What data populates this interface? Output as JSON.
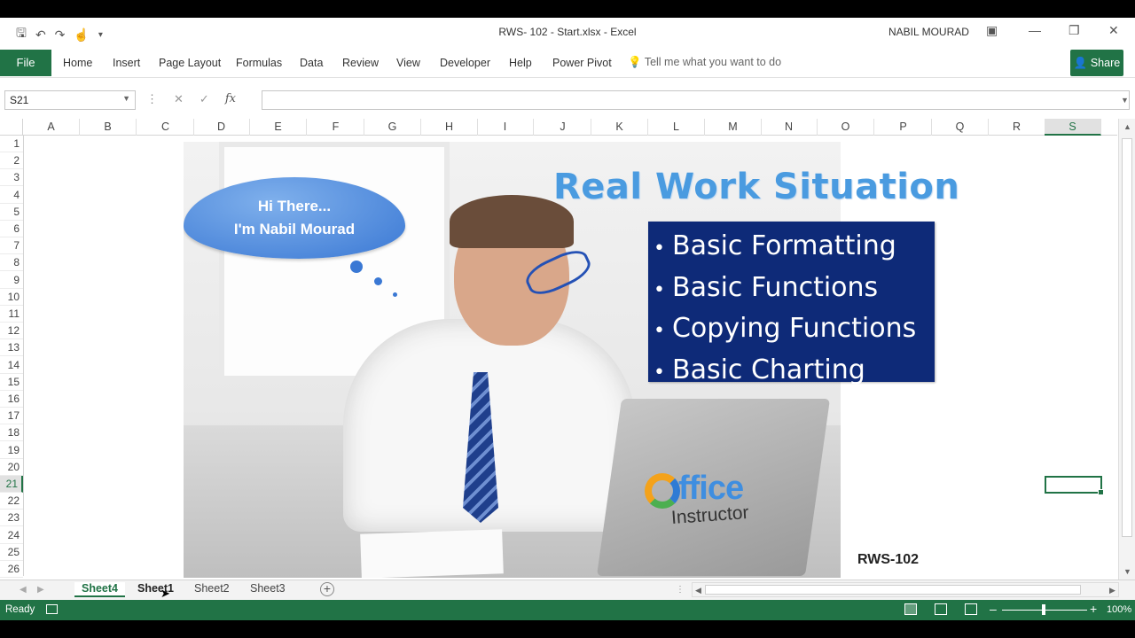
{
  "window": {
    "title": "RWS- 102 - Start.xlsx  -  Excel",
    "user": "NABIL MOURAD"
  },
  "ribbon": {
    "file": "File",
    "tabs": [
      "Home",
      "Insert",
      "Page Layout",
      "Formulas",
      "Data",
      "Review",
      "View",
      "Developer",
      "Help",
      "Power Pivot"
    ],
    "tell_me": "Tell me what you want to do",
    "share": "Share"
  },
  "formula_bar": {
    "name_box": "S21",
    "formula": ""
  },
  "columns": [
    "A",
    "B",
    "C",
    "D",
    "E",
    "F",
    "G",
    "H",
    "I",
    "J",
    "K",
    "L",
    "M",
    "N",
    "O",
    "P",
    "Q",
    "R",
    "S"
  ],
  "rows": [
    "1",
    "2",
    "3",
    "4",
    "5",
    "6",
    "7",
    "8",
    "9",
    "10",
    "11",
    "12",
    "13",
    "14",
    "15",
    "16",
    "17",
    "18",
    "19",
    "20",
    "21",
    "22",
    "23",
    "24",
    "25",
    "26"
  ],
  "selected": {
    "column": "S",
    "row": "21"
  },
  "slide": {
    "cloud_line1": "Hi There...",
    "cloud_line2": "I'm Nabil Mourad",
    "title": "Real Work Situation",
    "topics": [
      "Basic Formatting",
      "Basic Functions",
      "Copying Functions",
      "Basic Charting"
    ],
    "logo_main": "ffice",
    "logo_sub": "Instructor",
    "code": "RWS-102",
    "colors": {
      "title": "#4a9be0",
      "topic_box": "#0e2a78",
      "cloud": "#3a78d4"
    }
  },
  "sheets": {
    "tabs": [
      "Sheet4",
      "Sheet1",
      "Sheet2",
      "Sheet3"
    ],
    "active": "Sheet4"
  },
  "status": {
    "ready": "Ready",
    "zoom": "100%"
  },
  "theme": {
    "accent": "#217346"
  }
}
